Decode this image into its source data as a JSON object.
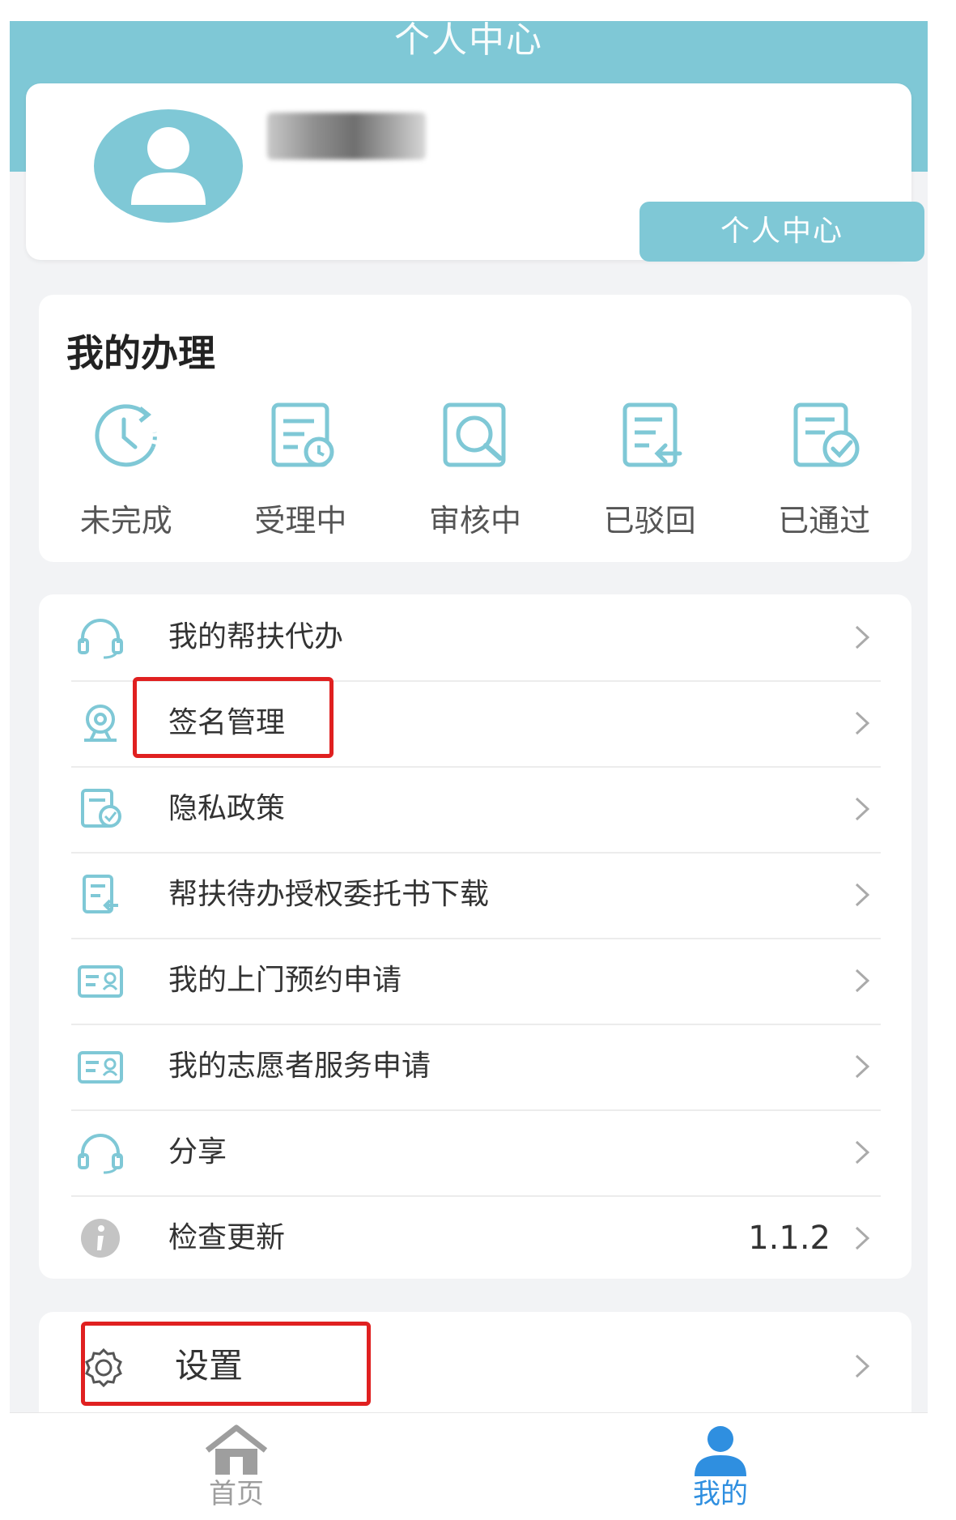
{
  "header": {
    "title": "个人中心"
  },
  "profile": {
    "button_label": "个人中心"
  },
  "my_handling": {
    "title": "我的办理",
    "statuses": [
      {
        "label": "未完成",
        "icon": "clock-refresh-icon"
      },
      {
        "label": "受理中",
        "icon": "document-clock-icon"
      },
      {
        "label": "审核中",
        "icon": "document-search-icon"
      },
      {
        "label": "已驳回",
        "icon": "document-return-icon"
      },
      {
        "label": "已通过",
        "icon": "document-check-icon"
      }
    ]
  },
  "menu": {
    "items": [
      {
        "label": "我的帮扶代办",
        "icon": "headset-icon"
      },
      {
        "label": "签名管理",
        "icon": "signature-icon"
      },
      {
        "label": "隐私政策",
        "icon": "document-check-icon"
      },
      {
        "label": "帮扶待办授权委托书下载",
        "icon": "document-download-icon"
      },
      {
        "label": "我的上门预约申请",
        "icon": "id-card-icon"
      },
      {
        "label": "我的志愿者服务申请",
        "icon": "id-card-icon"
      },
      {
        "label": "分享",
        "icon": "headset-icon"
      },
      {
        "label": "检查更新",
        "icon": "info-icon",
        "value": "1.1.2"
      }
    ]
  },
  "settings": {
    "label": "设置",
    "icon": "gear-icon"
  },
  "tabbar": {
    "tabs": [
      {
        "label": "首页",
        "icon": "home-icon",
        "active": false
      },
      {
        "label": "我的",
        "icon": "user-icon",
        "active": true
      }
    ]
  },
  "colors": {
    "accent": "#7fc8d6",
    "tab_active": "#2f8fe0",
    "tab_inactive": "#9e9e9e",
    "highlight": "#e02020"
  }
}
